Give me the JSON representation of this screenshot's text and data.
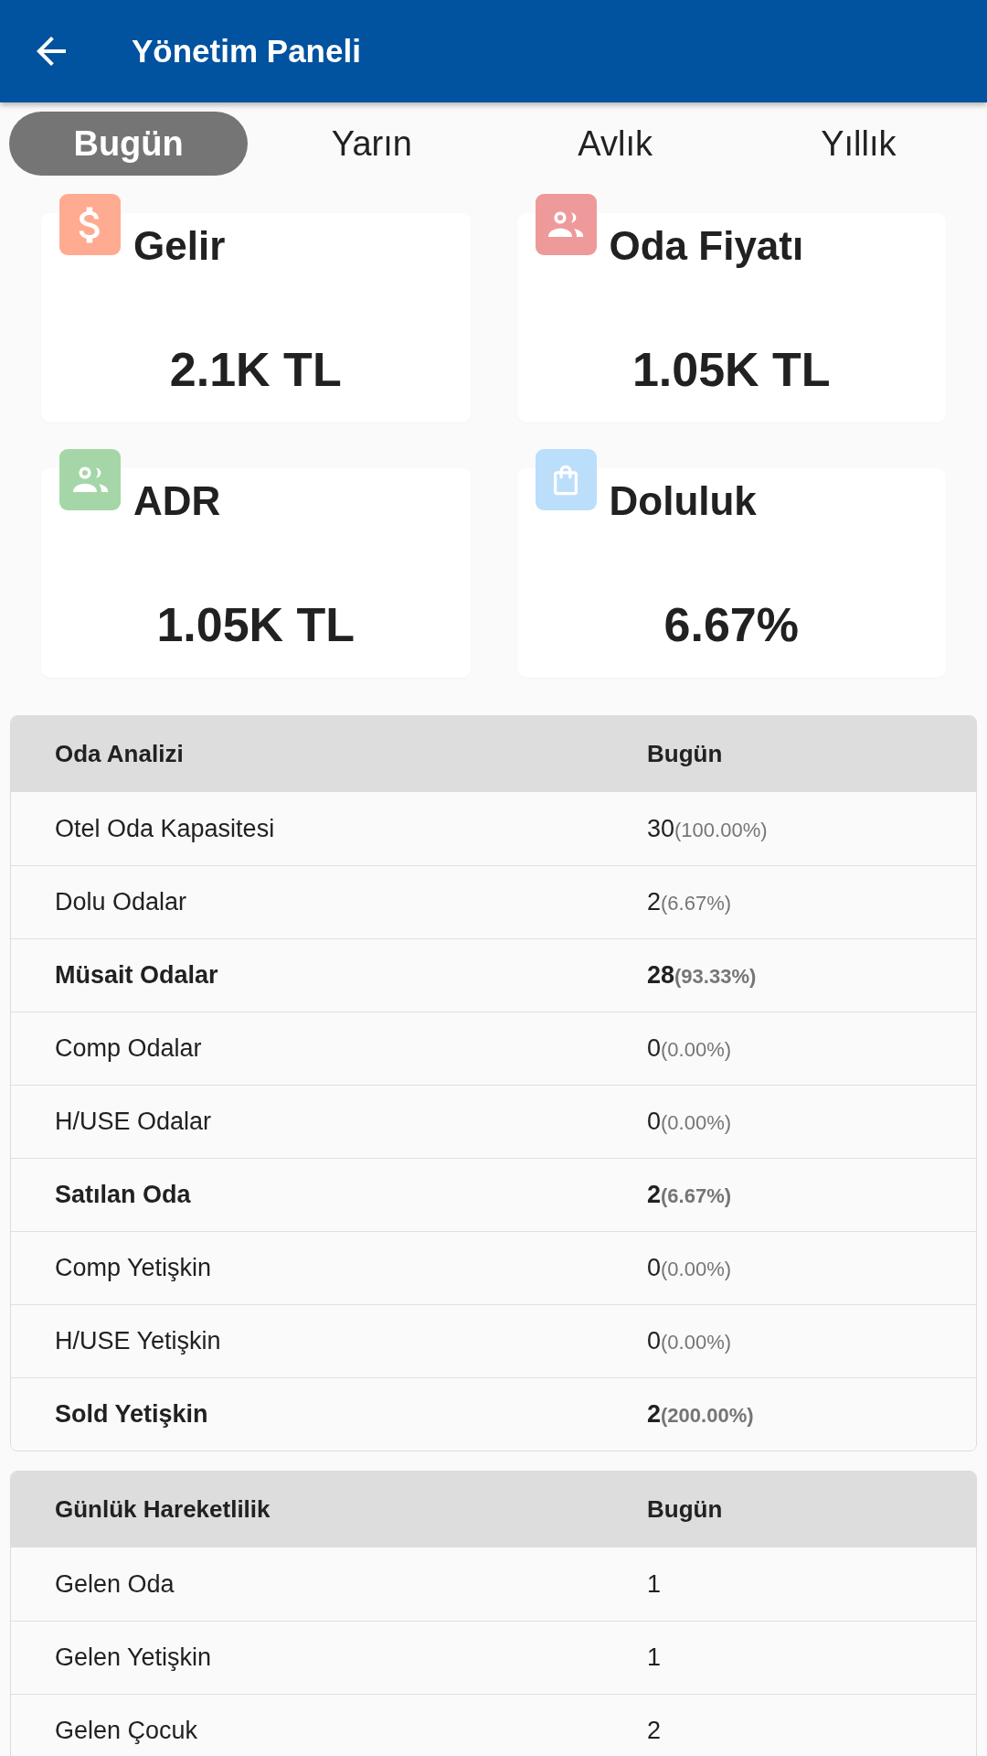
{
  "app_bar": {
    "title": "Yönetim Paneli"
  },
  "tabs": [
    {
      "label": "Bugün",
      "selected": true
    },
    {
      "label": "Yarın",
      "selected": false
    },
    {
      "label": "Avlık",
      "selected": false
    },
    {
      "label": "Yıllık",
      "selected": false
    }
  ],
  "cards": [
    {
      "title": "Gelir",
      "value": "2.1K TL",
      "color": "#ffab91"
    },
    {
      "title": "Oda Fiyatı",
      "value": "1.05K TL",
      "color": "#ef9a9a"
    },
    {
      "title": "ADR",
      "value": "1.05K TL",
      "color": "#a5d6a7"
    },
    {
      "title": "Doluluk",
      "value": "6.67%",
      "color": "#bbdefb"
    }
  ],
  "tables": [
    {
      "columns": [
        "Oda Analizi",
        "Bugün"
      ],
      "rows": [
        {
          "label": "Otel Oda Kapasitesi",
          "value": "30",
          "share": "(100.00%)",
          "bold": false
        },
        {
          "label": "Dolu Odalar",
          "value": "2",
          "share": "(6.67%)",
          "bold": false
        },
        {
          "label": "Müsait Odalar",
          "value": "28",
          "share": "(93.33%)",
          "bold": true
        },
        {
          "label": "Comp Odalar",
          "value": "0",
          "share": "(0.00%)",
          "bold": false
        },
        {
          "label": "H/USE Odalar",
          "value": "0",
          "share": "(0.00%)",
          "bold": false
        },
        {
          "label": "Satılan Oda",
          "value": "2",
          "share": "(6.67%)",
          "bold": true
        },
        {
          "label": "Comp Yetişkin",
          "value": "0",
          "share": "(0.00%)",
          "bold": false
        },
        {
          "label": "H/USE Yetişkin",
          "value": "0",
          "share": "(0.00%)",
          "bold": false
        },
        {
          "label": "Sold Yetişkin",
          "value": "2",
          "share": "(200.00%)",
          "bold": true
        }
      ]
    },
    {
      "columns": [
        "Günlük Hareketlilik",
        "Bugün"
      ],
      "rows": [
        {
          "label": "Gelen Oda",
          "value": "1",
          "bold": false
        },
        {
          "label": "Gelen Yetişkin",
          "value": "1",
          "bold": false
        },
        {
          "label": "Gelen Çocuk",
          "value": "2",
          "bold": false
        }
      ]
    }
  ]
}
